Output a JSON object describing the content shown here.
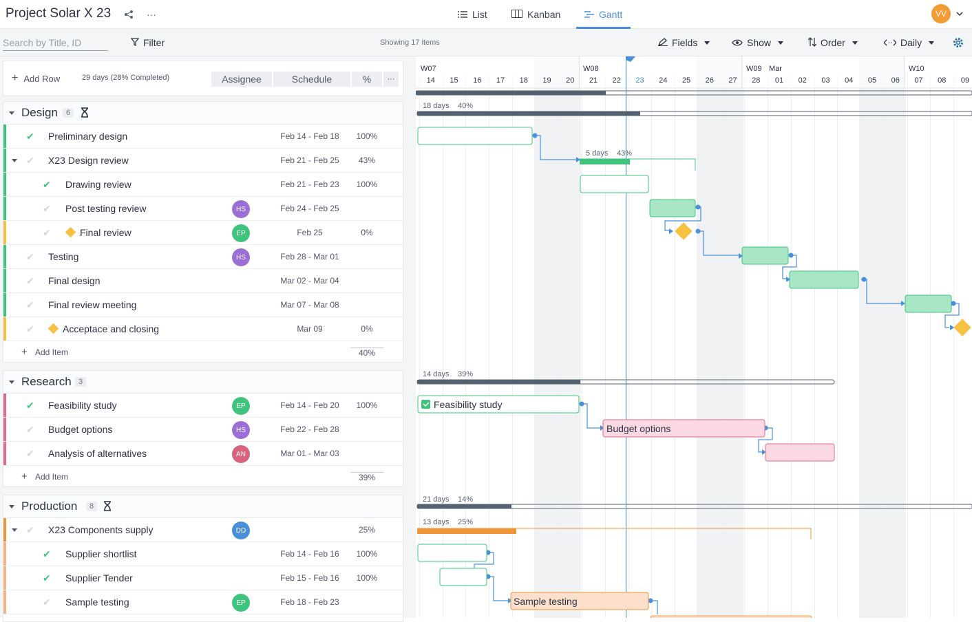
{
  "app": {
    "title": "Project Solar X 23",
    "avatar_initials": "VV"
  },
  "views": [
    {
      "label": "List"
    },
    {
      "label": "Kanban"
    },
    {
      "label": "Gantt"
    }
  ],
  "toolbar": {
    "search_placeholder": "Search by Title, ID",
    "filter_label": "Filter",
    "showing": "Showing 17 items",
    "fields_label": "Fields",
    "show_label": "Show",
    "order_label": "Order",
    "scale_label": "Daily"
  },
  "grid": {
    "add_row_label": "Add Row",
    "summary": "29 days (28% Completed)",
    "col_assignee": "Assignee",
    "col_schedule": "Schedule",
    "col_pct": "%",
    "more": "···",
    "add_item_label": "Add Item"
  },
  "sections": [
    {
      "name": "Design",
      "count": "6",
      "footer_pct": "40%"
    },
    {
      "name": "Research",
      "count": "3",
      "footer_pct": "39%"
    },
    {
      "name": "Production",
      "count": "8"
    }
  ],
  "rows": [
    {
      "name": "Preliminary design",
      "schedule": "Feb 14 - Feb 18",
      "pct": "100%"
    },
    {
      "name": "X23 Design review",
      "schedule": "Feb 21 - Feb 25",
      "pct": "43%"
    },
    {
      "name": "Drawing review",
      "schedule": "Feb 21 - Feb 23",
      "pct": "100%"
    },
    {
      "name": "Post testing review",
      "assignee": "HS",
      "schedule": "Feb 24 - Feb 25",
      "pct": ""
    },
    {
      "name": "Final review",
      "assignee": "EP",
      "schedule": "Feb 25",
      "pct": "0%"
    },
    {
      "name": "Testing",
      "assignee": "HS",
      "schedule": "Feb 28 - Mar 01",
      "pct": ""
    },
    {
      "name": "Final design",
      "schedule": "Mar 02 - Mar 04",
      "pct": ""
    },
    {
      "name": "Final review meeting",
      "schedule": "Mar 07 - Mar 08",
      "pct": ""
    },
    {
      "name": "Acceptace and closing",
      "schedule": "Mar 09",
      "pct": "0%"
    },
    {
      "name": "Feasibility study",
      "assignee": "EP",
      "schedule": "Feb 14 - Feb 20",
      "pct": "100%"
    },
    {
      "name": "Budget options",
      "assignee": "HS",
      "schedule": "Feb 22 - Feb 28",
      "pct": ""
    },
    {
      "name": "Analysis of alternatives",
      "assignee": "AN",
      "schedule": "Mar 01 - Mar 03",
      "pct": ""
    },
    {
      "name": "X23 Components supply",
      "assignee": "DD",
      "schedule": "",
      "pct": "25%"
    },
    {
      "name": "Supplier shortlist",
      "schedule": "Feb 14 - Feb 16",
      "pct": "100%"
    },
    {
      "name": "Supplier Tender",
      "schedule": "Feb 15 - Feb 16",
      "pct": "100%"
    },
    {
      "name": "Sample testing",
      "assignee": "EP",
      "schedule": "Feb 18 - Feb 23",
      "pct": ""
    }
  ],
  "gantt": {
    "weeks": [
      "W07",
      "W08",
      "W09",
      "W10"
    ],
    "month": "Mar",
    "days": [
      "3",
      "14",
      "15",
      "16",
      "17",
      "18",
      "19",
      "20",
      "21",
      "22",
      "23",
      "24",
      "25",
      "26",
      "27",
      "28",
      "01",
      "02",
      "03",
      "04",
      "05",
      "06",
      "07",
      "08",
      "09"
    ],
    "design_summary": {
      "days": "18 days",
      "pct": "40%"
    },
    "design_review_summary": {
      "days": "5 days",
      "pct": "43%"
    },
    "research_summary": {
      "days": "14 days",
      "pct": "39%"
    },
    "production_summary": {
      "days": "21 days",
      "pct": "14%"
    },
    "components_summary": {
      "days": "13 days",
      "pct": "25%"
    },
    "bar_feasibility": "Feasibility study",
    "bar_budget": "Budget options",
    "bar_sample": "Sample testing"
  },
  "colors": {
    "accent": "#4a90d9",
    "green": "#3ec47d",
    "yellow": "#f5c242",
    "pink": "#e36a88",
    "orange": "#f0963a",
    "purple": "#9b6fd6"
  }
}
